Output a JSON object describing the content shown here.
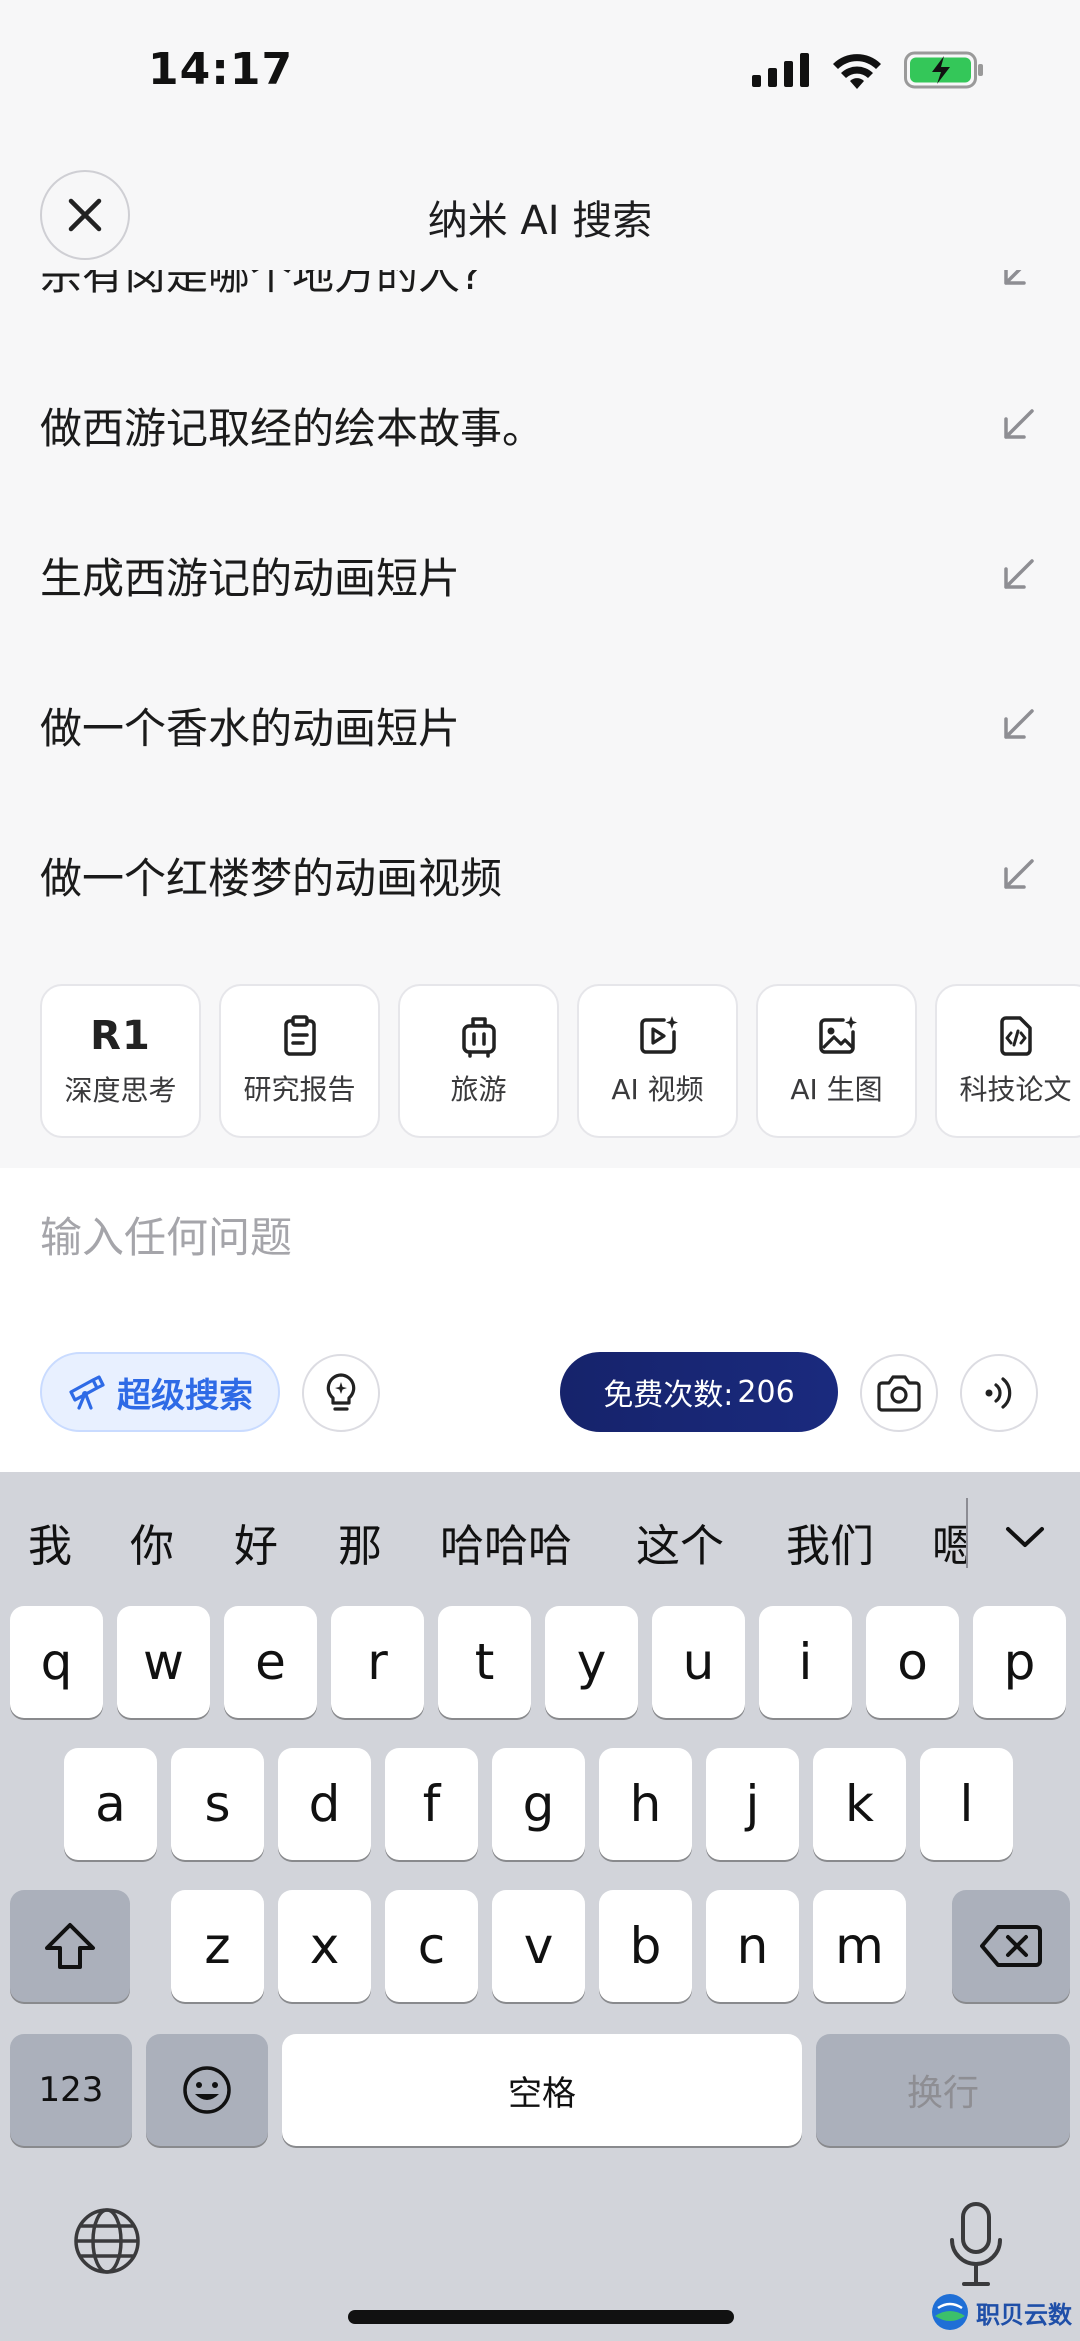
{
  "status_bar": {
    "time": "14:17"
  },
  "header": {
    "title": "纳米 AI 搜索"
  },
  "suggestions": [
    {
      "text": "宗有岗是哪个地方的人?"
    },
    {
      "text": "做西游记取经的绘本故事。"
    },
    {
      "text": "生成西游记的动画短片"
    },
    {
      "text": "做一个香水的动画短片"
    },
    {
      "text": "做一个红楼梦的动画视频"
    }
  ],
  "chips": [
    {
      "label": "深度思考",
      "icon": "r1-text",
      "badge": "R1"
    },
    {
      "label": "研究报告",
      "icon": "clipboard-icon"
    },
    {
      "label": "旅游",
      "icon": "luggage-icon"
    },
    {
      "label": "AI 视频",
      "icon": "video-sparkle-icon"
    },
    {
      "label": "AI 生图",
      "icon": "image-sparkle-icon"
    },
    {
      "label": "科技论文",
      "icon": "code-doc-icon"
    }
  ],
  "composer": {
    "placeholder": "输入任何问题",
    "super_search_label": "超级搜索",
    "free_count_label": "免费次数:",
    "free_count_value": "206"
  },
  "keyboard": {
    "candidates": [
      "我",
      "你",
      "好",
      "那",
      "哈哈哈",
      "这个",
      "我们",
      "嗯"
    ],
    "row1": [
      "q",
      "w",
      "e",
      "r",
      "t",
      "y",
      "u",
      "i",
      "o",
      "p"
    ],
    "row2": [
      "a",
      "s",
      "d",
      "f",
      "g",
      "h",
      "j",
      "k",
      "l"
    ],
    "row3": [
      "z",
      "x",
      "c",
      "v",
      "b",
      "n",
      "m"
    ],
    "numbers_label": "123",
    "space_label": "空格",
    "return_label": "换行"
  },
  "watermark": {
    "text": "职贝云数"
  },
  "colors": {
    "accent_blue": "#2e6ae6",
    "counter_bg": "#16236b",
    "battery_green": "#34c759",
    "keyboard_bg": "#d2d4da"
  }
}
